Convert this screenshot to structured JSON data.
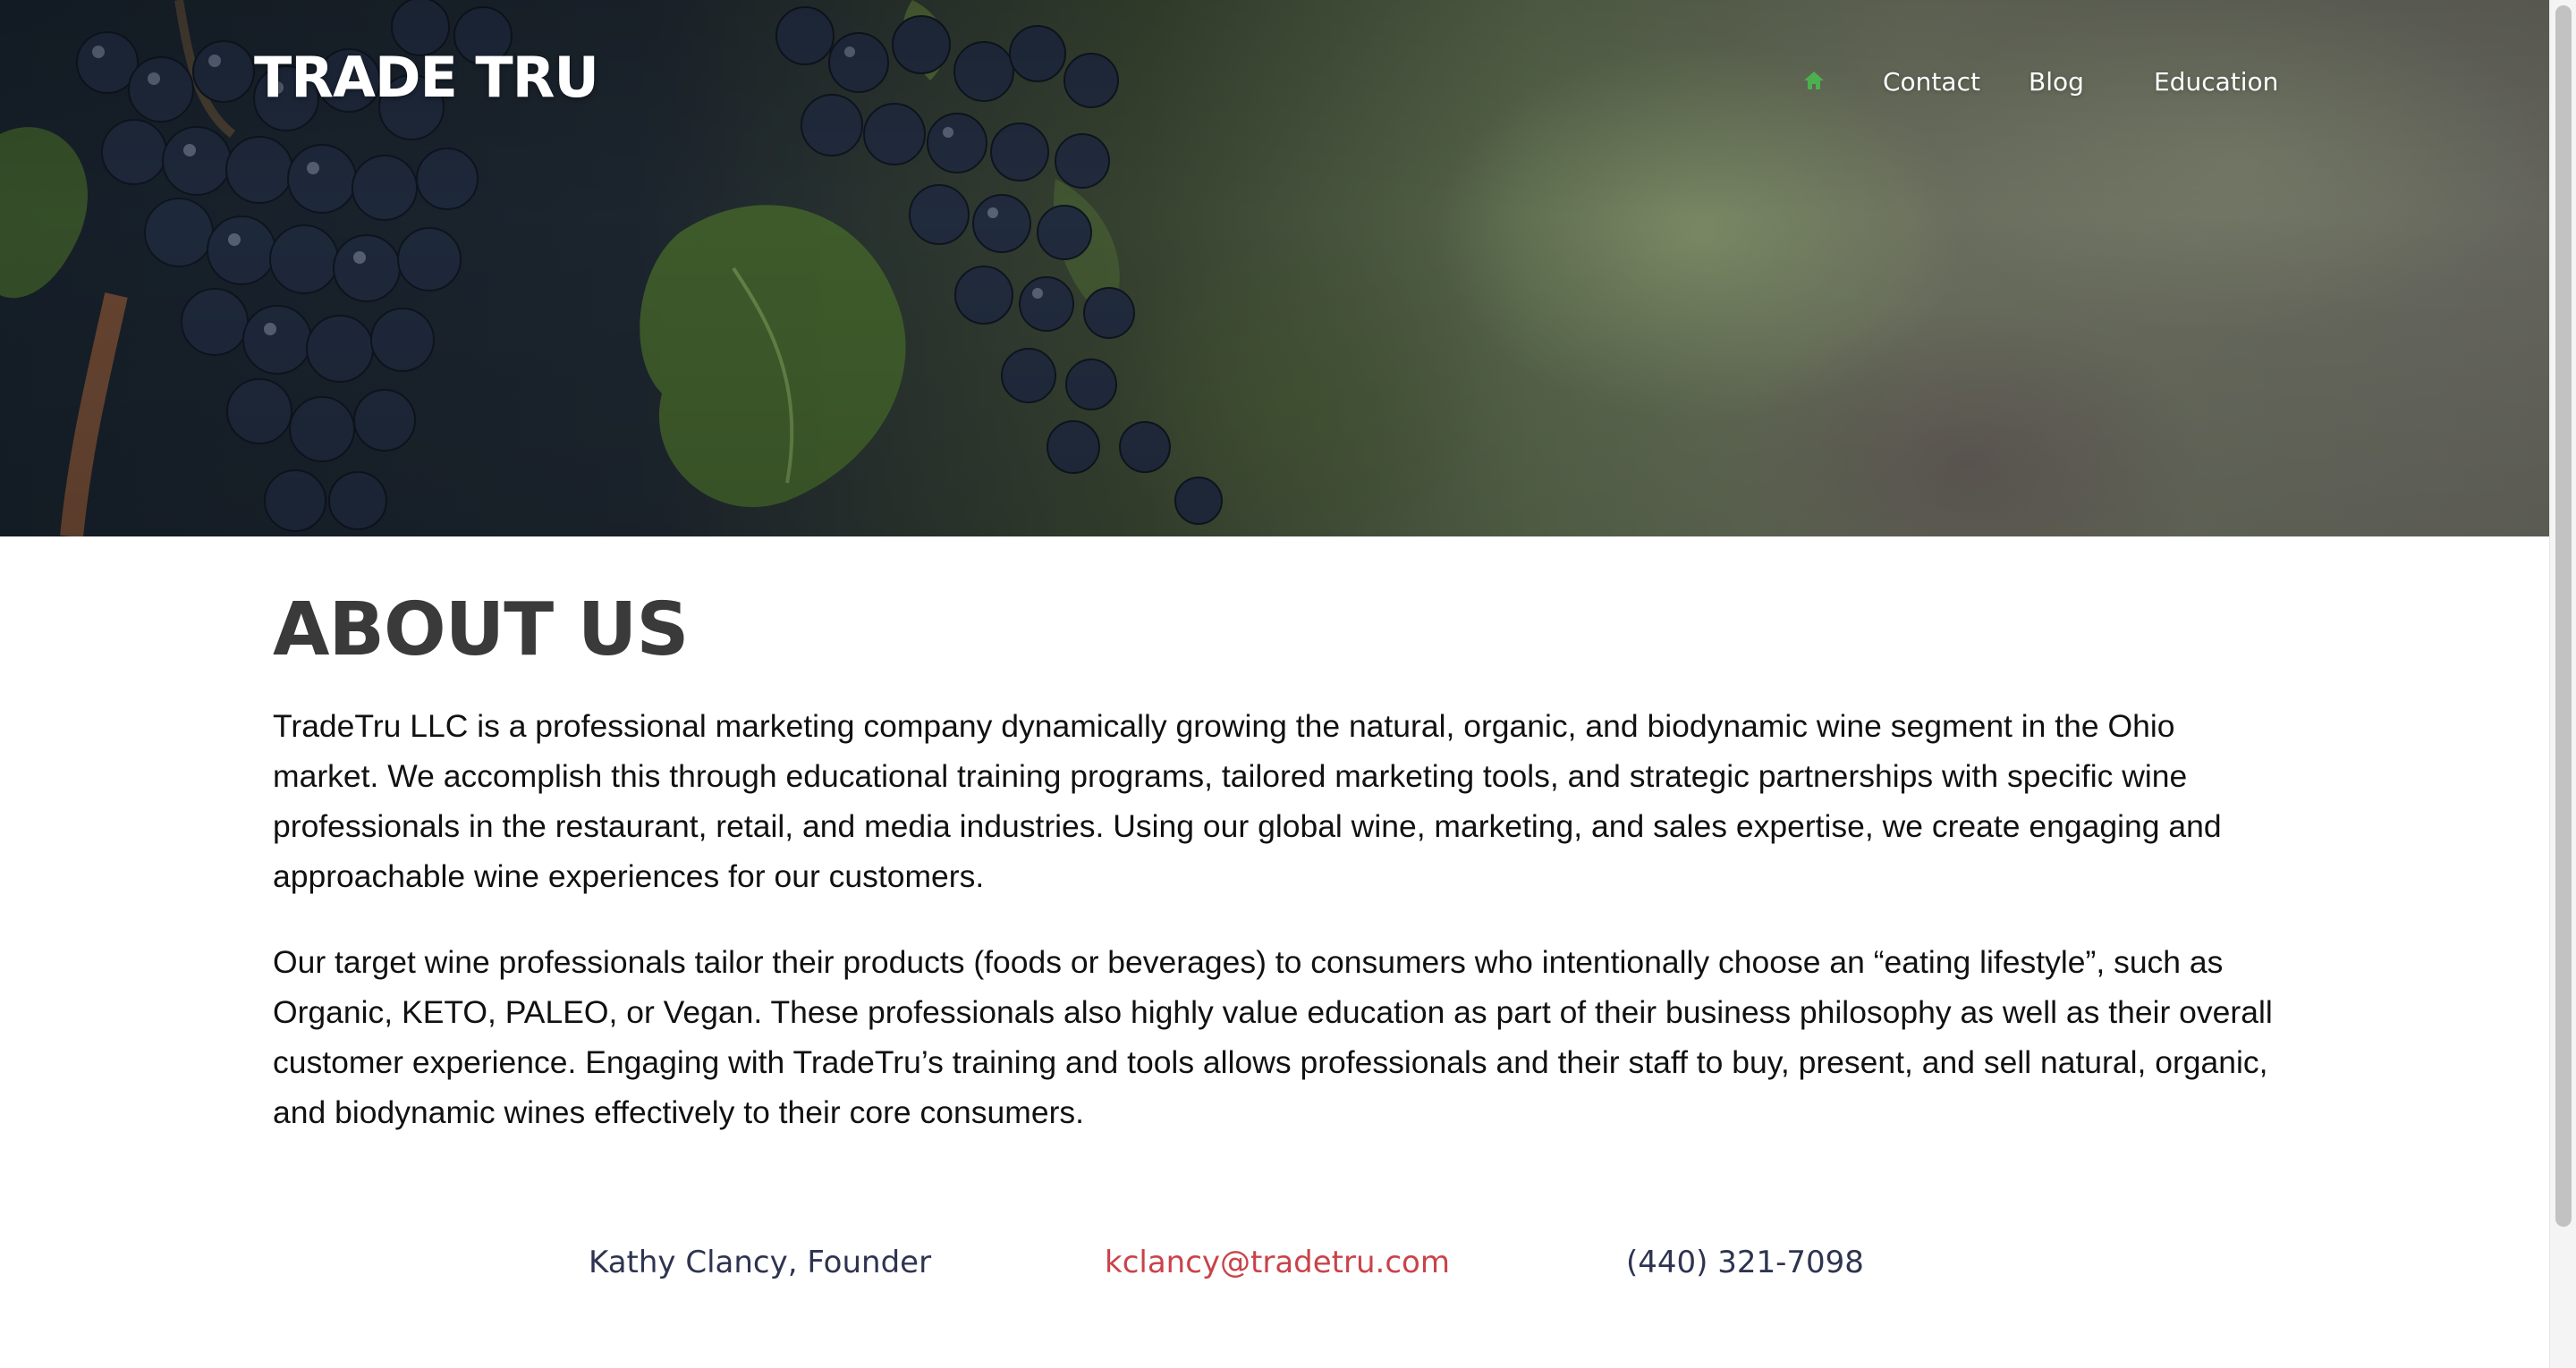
{
  "header": {
    "logo": "TRADE TRU",
    "nav": {
      "home_icon": "home-icon",
      "home_color": "#4caf50",
      "contact": "Contact",
      "blog": "Blog",
      "education": "Education"
    }
  },
  "about": {
    "title": "ABOUT US",
    "paragraphs": [
      "TradeTru LLC is a professional marketing company dynamically growing the natural, organic, and biodynamic wine segment in the Ohio market. We accomplish this through educational training programs, tailored marketing tools, and strategic partnerships with specific wine professionals in the restaurant, retail, and media industries. Using our global wine, marketing, and sales expertise, we create engaging and approachable wine experiences for our customers.",
      "Our target wine professionals tailor their products (foods or beverages) to consumers who intentionally choose an “eating lifestyle”, such as Organic, KETO, PALEO, or Vegan. These professionals also highly value education as part of their business philosophy as well as their overall customer experience. Engaging with TradeTru’s training and tools allows professionals and their staff to buy, present, and sell natural, organic, and biodynamic wines effectively to their core consumers."
    ]
  },
  "contact": {
    "name": "Kathy Clancy, Founder",
    "email": "kclancy@tradetru.com",
    "phone": "(440) 321-7098"
  },
  "colors": {
    "title": "#3b3a3a",
    "email": "#c9434a",
    "contact_text": "#2e3450"
  }
}
